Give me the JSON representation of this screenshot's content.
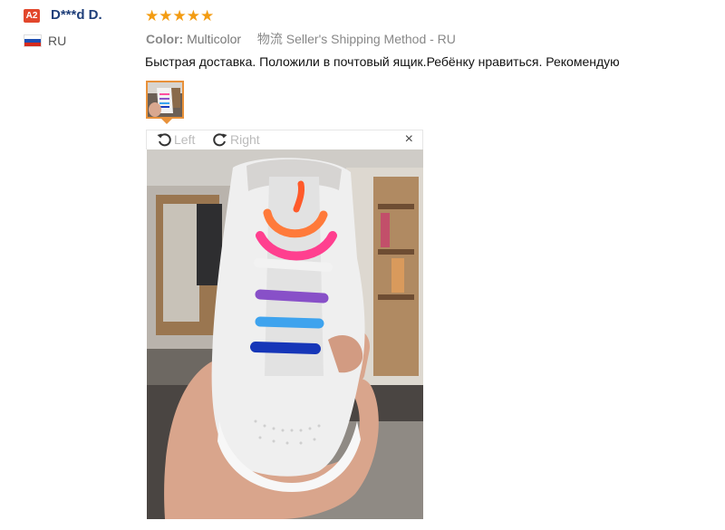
{
  "user": {
    "badge": "A2",
    "name": "D***d D.",
    "country": "RU"
  },
  "review": {
    "stars": "★★★★★",
    "rating": 5,
    "color_label": "Color:",
    "color_value": "Multicolor",
    "shipping_icon_text": "物流",
    "shipping": "Seller's Shipping Method - RU",
    "text": "Быстрая доставка. Положили в почтовый ящик.Ребёнку нравиться. Рекомендую"
  },
  "viewer": {
    "rotate_left": "Left",
    "rotate_right": "Right",
    "close": "×"
  },
  "colors": {
    "accent": "#e8913a",
    "star": "#f39c12",
    "username": "#1f3f7a",
    "badge": "#e2472c"
  }
}
